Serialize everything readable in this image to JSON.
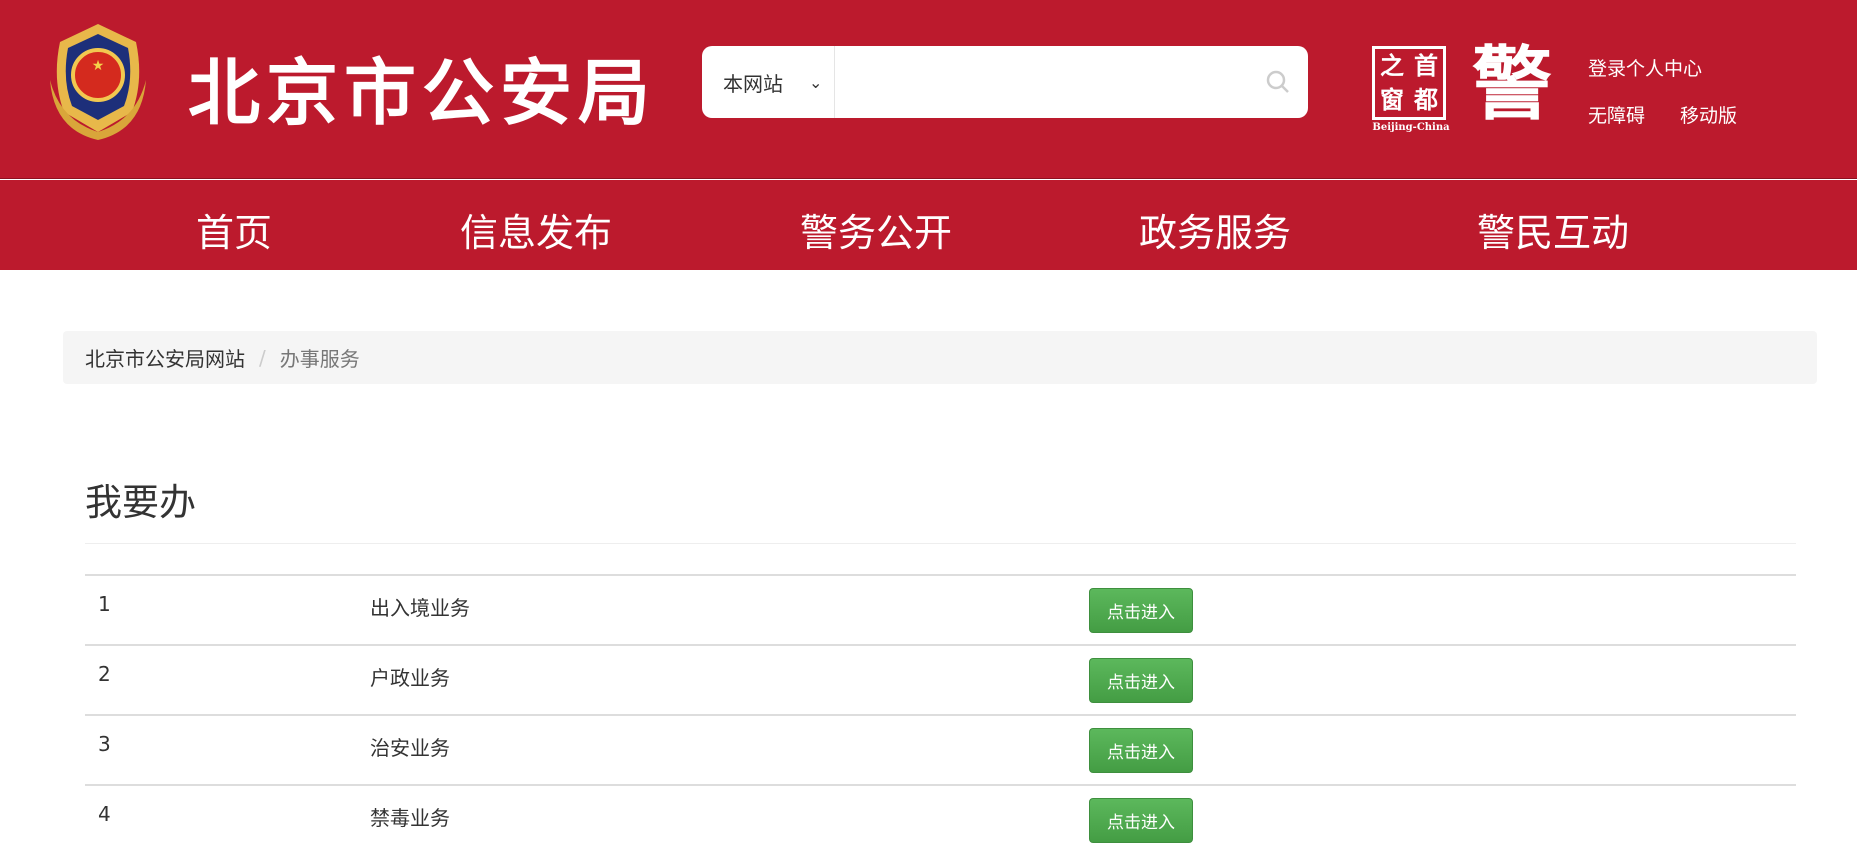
{
  "header": {
    "site_title": "北京市公安局",
    "search": {
      "scope": "本网站",
      "placeholder": ""
    },
    "logo_capital": {
      "chars": [
        "之",
        "首",
        "窗",
        "都"
      ],
      "caption": "Beijing-China"
    },
    "logo_police": "警",
    "links": {
      "login": "登录个人中心",
      "accessibility": "无障碍",
      "mobile": "移动版"
    }
  },
  "nav": [
    "首页",
    "信息发布",
    "警务公开",
    "政务服务",
    "警民互动"
  ],
  "breadcrumb": {
    "home": "北京市公安局网站",
    "current": "办事服务"
  },
  "section_title": "我要办",
  "rows": [
    {
      "num": "1",
      "name": "出入境业务",
      "button": "点击进入"
    },
    {
      "num": "2",
      "name": "户政业务",
      "button": "点击进入"
    },
    {
      "num": "3",
      "name": "治安业务",
      "button": "点击进入"
    },
    {
      "num": "4",
      "name": "禁毒业务",
      "button": "点击进入"
    }
  ],
  "colors": {
    "brand_red": "#bc1a2d",
    "button_green": "#4cae4c"
  }
}
